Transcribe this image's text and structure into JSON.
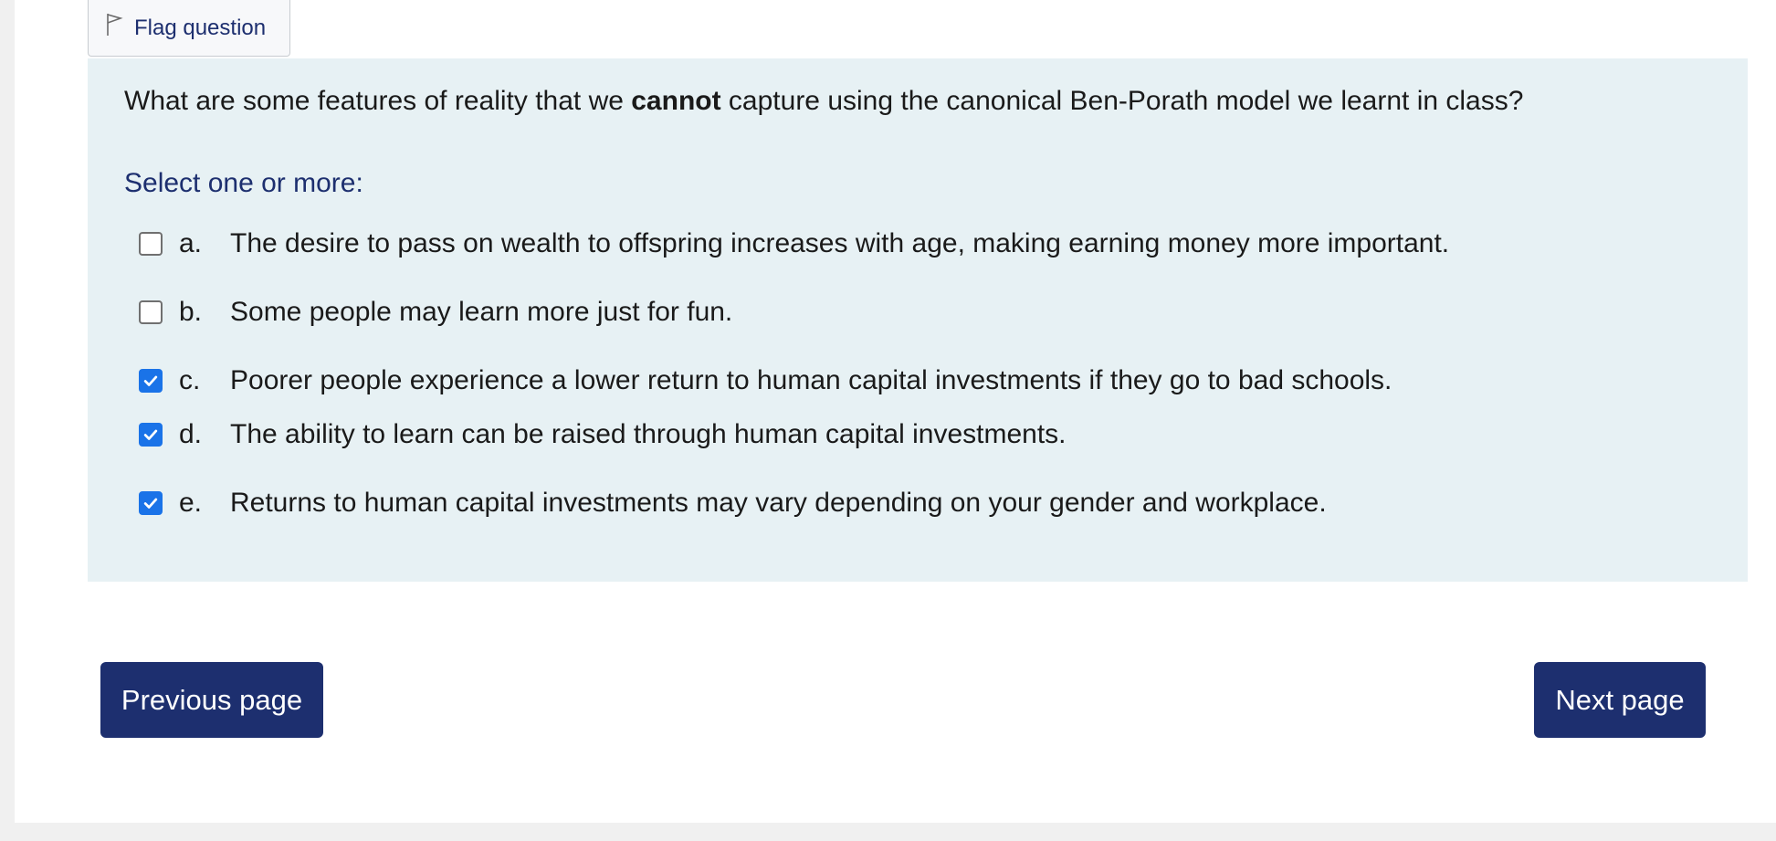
{
  "flag": {
    "label": "Flag question"
  },
  "question": {
    "text_before": "What are some features of reality that we ",
    "text_bold": "cannot",
    "text_after": " capture using the canonical Ben-Porath model we learnt in class?",
    "prompt": "Select one or more:"
  },
  "answers": [
    {
      "letter": "a.",
      "text": "The desire to pass on wealth to offspring increases with age, making earning money more important.",
      "checked": false
    },
    {
      "letter": "b.",
      "text": "Some people may learn more just for fun.",
      "checked": false
    },
    {
      "letter": "c.",
      "text": "Poorer people experience a lower return to human capital investments if they go to bad schools.",
      "checked": true
    },
    {
      "letter": "d.",
      "text": "The ability to learn can be raised through human capital investments.",
      "checked": true
    },
    {
      "letter": "e.",
      "text": "Returns to human capital investments may vary depending on your gender and workplace.",
      "checked": true
    }
  ],
  "navigation": {
    "previous_label": "Previous page",
    "next_label": "Next page"
  },
  "colors": {
    "primary": "#1d2f6f",
    "question_bg": "#e7f1f4",
    "checkbox_checked": "#1a73e8"
  }
}
